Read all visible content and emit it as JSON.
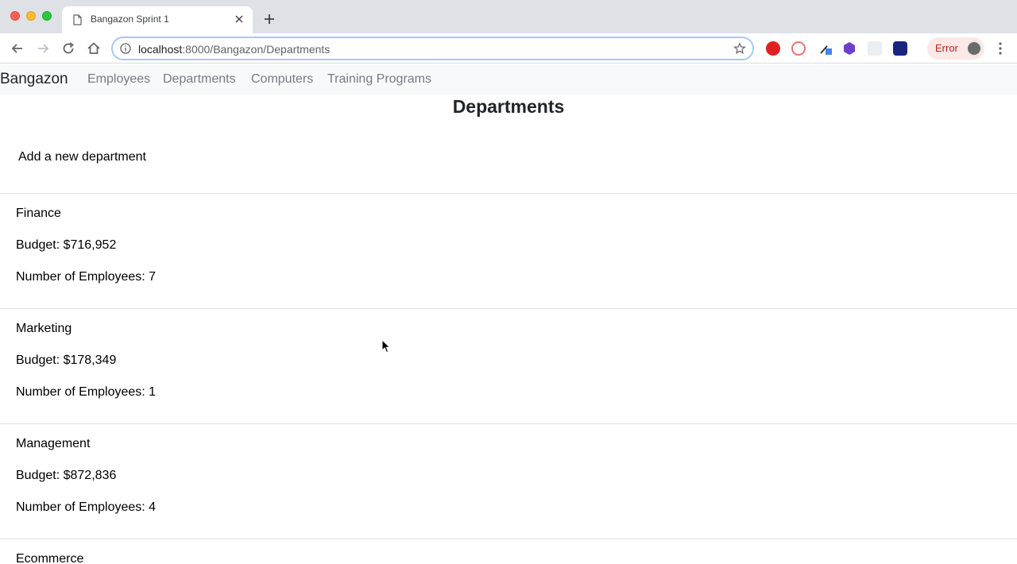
{
  "browser": {
    "tab_title": "Bangazon Sprint 1",
    "url_host": "localhost",
    "url_rest": ":8000/Bangazon/Departments",
    "error_label": "Error"
  },
  "navbar": {
    "brand": "Bangazon",
    "links": [
      "Employees",
      "Departments",
      "Computers",
      "Training Programs"
    ]
  },
  "page": {
    "title": "Departments",
    "add_link": "Add a new department"
  },
  "departments": [
    {
      "name": "Finance",
      "budget": "Budget: $716,952",
      "employees": "Number of Employees: 7"
    },
    {
      "name": "Marketing",
      "budget": "Budget: $178,349",
      "employees": "Number of Employees: 1"
    },
    {
      "name": "Management",
      "budget": "Budget: $872,836",
      "employees": "Number of Employees: 4"
    },
    {
      "name": "Ecommerce"
    }
  ],
  "colors": {
    "toolbar_accent": "#a8c7fa",
    "error_text": "#c5221f",
    "navbar_bg": "#f8f9fa"
  }
}
